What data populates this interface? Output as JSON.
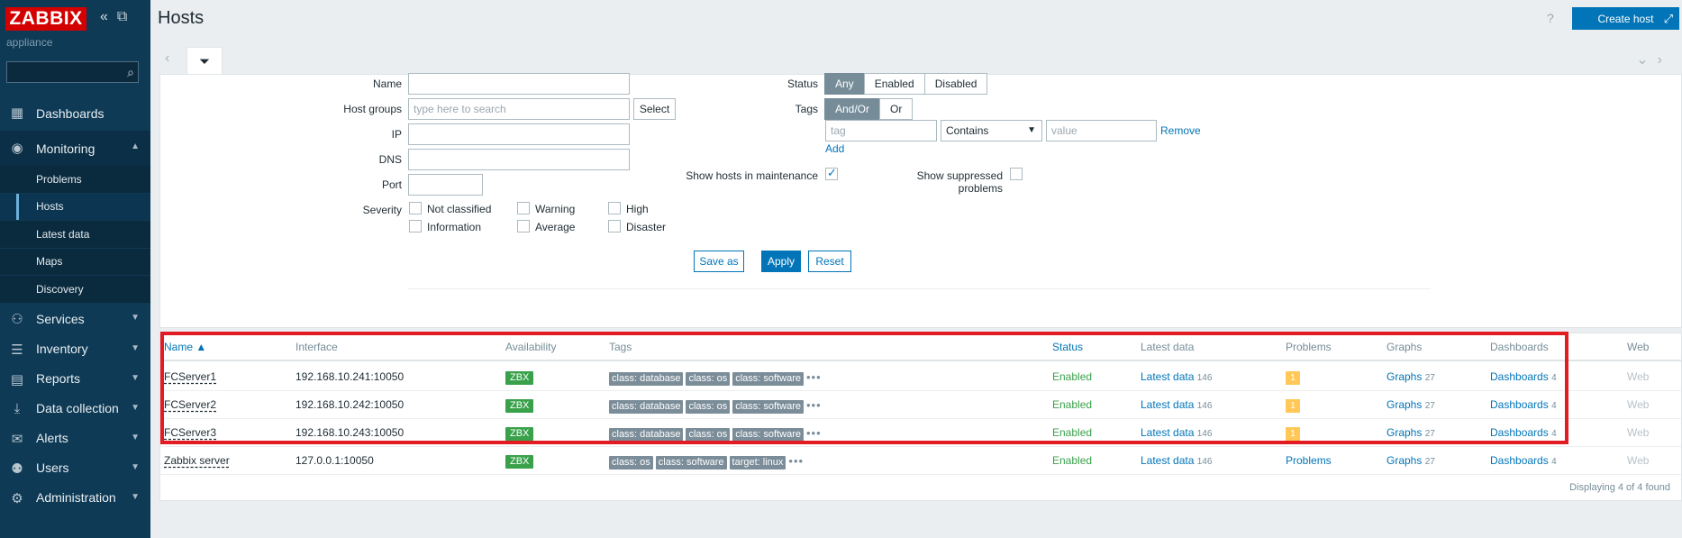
{
  "sidebar": {
    "logo": "ZABBIX",
    "subtitle": "appliance",
    "search_value": "",
    "menu": [
      {
        "label": "Dashboards",
        "icon": "dashboard-icon"
      },
      {
        "label": "Monitoring",
        "icon": "eye-icon",
        "expanded": true
      },
      {
        "label": "Services",
        "icon": "services-icon"
      },
      {
        "label": "Inventory",
        "icon": "list-icon"
      },
      {
        "label": "Reports",
        "icon": "report-icon"
      },
      {
        "label": "Data collection",
        "icon": "download-icon"
      },
      {
        "label": "Alerts",
        "icon": "envelope-icon"
      },
      {
        "label": "Users",
        "icon": "users-icon"
      },
      {
        "label": "Administration",
        "icon": "gear-icon"
      }
    ],
    "submenu": [
      "Problems",
      "Hosts",
      "Latest data",
      "Maps",
      "Discovery"
    ]
  },
  "header": {
    "title": "Hosts",
    "help": "?",
    "create_button": "Create host"
  },
  "filter": {
    "name_label": "Name",
    "host_groups_label": "Host groups",
    "host_groups_placeholder": "type here to search",
    "select_button": "Select",
    "ip_label": "IP",
    "dns_label": "DNS",
    "port_label": "Port",
    "severity_label": "Severity",
    "severities": [
      "Not classified",
      "Warning",
      "High",
      "Information",
      "Average",
      "Disaster"
    ],
    "status_label": "Status",
    "status_options": [
      "Any",
      "Enabled",
      "Disabled"
    ],
    "tags_label": "Tags",
    "tags_options": [
      "And/Or",
      "Or"
    ],
    "tag_placeholder": "tag",
    "operator_value": "Contains",
    "value_placeholder": "value",
    "remove_link": "Remove",
    "add_link": "Add",
    "maintenance_label": "Show hosts in maintenance",
    "suppressed_label": "Show suppressed problems",
    "save_as": "Save as",
    "apply": "Apply",
    "reset": "Reset"
  },
  "table": {
    "columns": [
      "Name",
      "Interface",
      "Availability",
      "Tags",
      "Status",
      "Latest data",
      "Problems",
      "Graphs",
      "Dashboards",
      "Web"
    ],
    "rows": [
      {
        "name": "FCServer1",
        "interface": "192.168.10.241:10050",
        "availability": "ZBX",
        "tags": [
          "class: database",
          "class: os",
          "class: software"
        ],
        "status": "Enabled",
        "latest": "Latest data",
        "latest_count": "146",
        "problems": "1",
        "graphs": "Graphs",
        "graphs_count": "27",
        "dashboards": "Dashboards",
        "dashboards_count": "4",
        "web": "Web"
      },
      {
        "name": "FCServer2",
        "interface": "192.168.10.242:10050",
        "availability": "ZBX",
        "tags": [
          "class: database",
          "class: os",
          "class: software"
        ],
        "status": "Enabled",
        "latest": "Latest data",
        "latest_count": "146",
        "problems": "1",
        "graphs": "Graphs",
        "graphs_count": "27",
        "dashboards": "Dashboards",
        "dashboards_count": "4",
        "web": "Web"
      },
      {
        "name": "FCServer3",
        "interface": "192.168.10.243:10050",
        "availability": "ZBX",
        "tags": [
          "class: database",
          "class: os",
          "class: software"
        ],
        "status": "Enabled",
        "latest": "Latest data",
        "latest_count": "146",
        "problems": "1",
        "graphs": "Graphs",
        "graphs_count": "27",
        "dashboards": "Dashboards",
        "dashboards_count": "4",
        "web": "Web"
      },
      {
        "name": "Zabbix server",
        "interface": "127.0.0.1:10050",
        "availability": "ZBX",
        "tags": [
          "class: os",
          "class: software",
          "target: linux"
        ],
        "status": "Enabled",
        "latest": "Latest data",
        "latest_count": "146",
        "problems": "Problems",
        "graphs": "Graphs",
        "graphs_count": "27",
        "dashboards": "Dashboards",
        "dashboards_count": "4",
        "web": "Web"
      }
    ],
    "footer": "Displaying 4 of 4 found"
  },
  "colors": {
    "accent": "#0275b8",
    "sidebar": "#0e3a56",
    "logo": "#d40000",
    "highlight": "#e31c24",
    "enabled": "#3aa14b"
  }
}
